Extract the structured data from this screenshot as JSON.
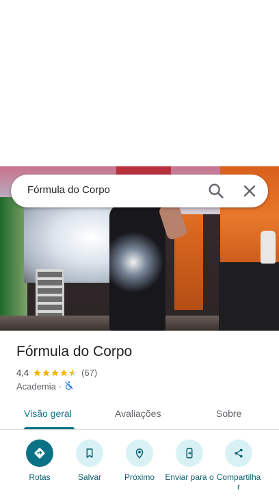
{
  "search": {
    "query": "Fórmula do Corpo"
  },
  "place": {
    "name": "Fórmula do Corpo",
    "rating": "4,4",
    "stars": 4.4,
    "review_count": "(67)",
    "category": "Academia",
    "separator": "·"
  },
  "tabs": [
    {
      "label": "Visão geral",
      "active": true
    },
    {
      "label": "Avaliações",
      "active": false
    },
    {
      "label": "Sobre",
      "active": false
    }
  ],
  "actions": [
    {
      "label": "Rotas",
      "icon": "directions-icon"
    },
    {
      "label": "Salvar",
      "icon": "bookmark-icon"
    },
    {
      "label": "Próximo",
      "icon": "nearby-icon"
    },
    {
      "label": "Enviar para o",
      "icon": "send-to-phone-icon"
    },
    {
      "label": "Compartilha r",
      "icon": "share-icon"
    }
  ],
  "colors": {
    "accent": "#0b7285",
    "action_bg": "#d8f1f5",
    "star": "#f4b400"
  }
}
